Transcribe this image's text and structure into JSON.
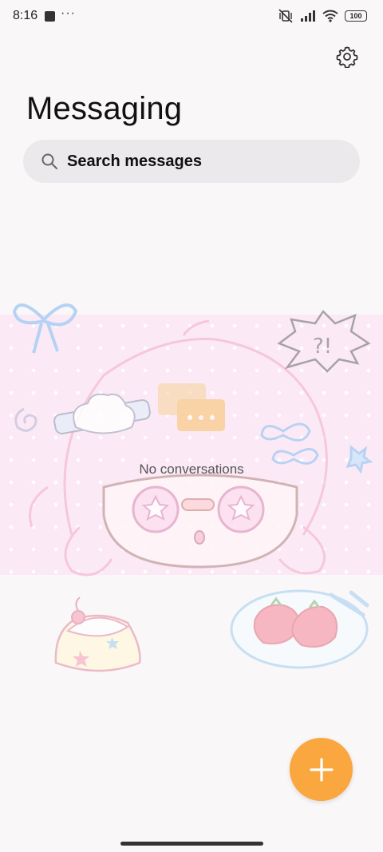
{
  "status_bar": {
    "time": "8:16",
    "overflow": "···",
    "battery": "100",
    "icons": [
      "notification-square-icon",
      "mute-vibrate-icon",
      "signal-icon",
      "wifi-icon",
      "battery-icon"
    ]
  },
  "header": {
    "title": "Messaging",
    "settings_icon": "gear-icon"
  },
  "search": {
    "placeholder": "Search messages",
    "icon": "search-icon"
  },
  "main": {
    "empty_text": "No conversations"
  },
  "fab": {
    "icon": "plus-icon"
  },
  "colors": {
    "accent": "#f9a73e",
    "background": "#faf7f8",
    "search_bg": "#ece9ec",
    "wallpaper_band": "#fbeaf6"
  }
}
